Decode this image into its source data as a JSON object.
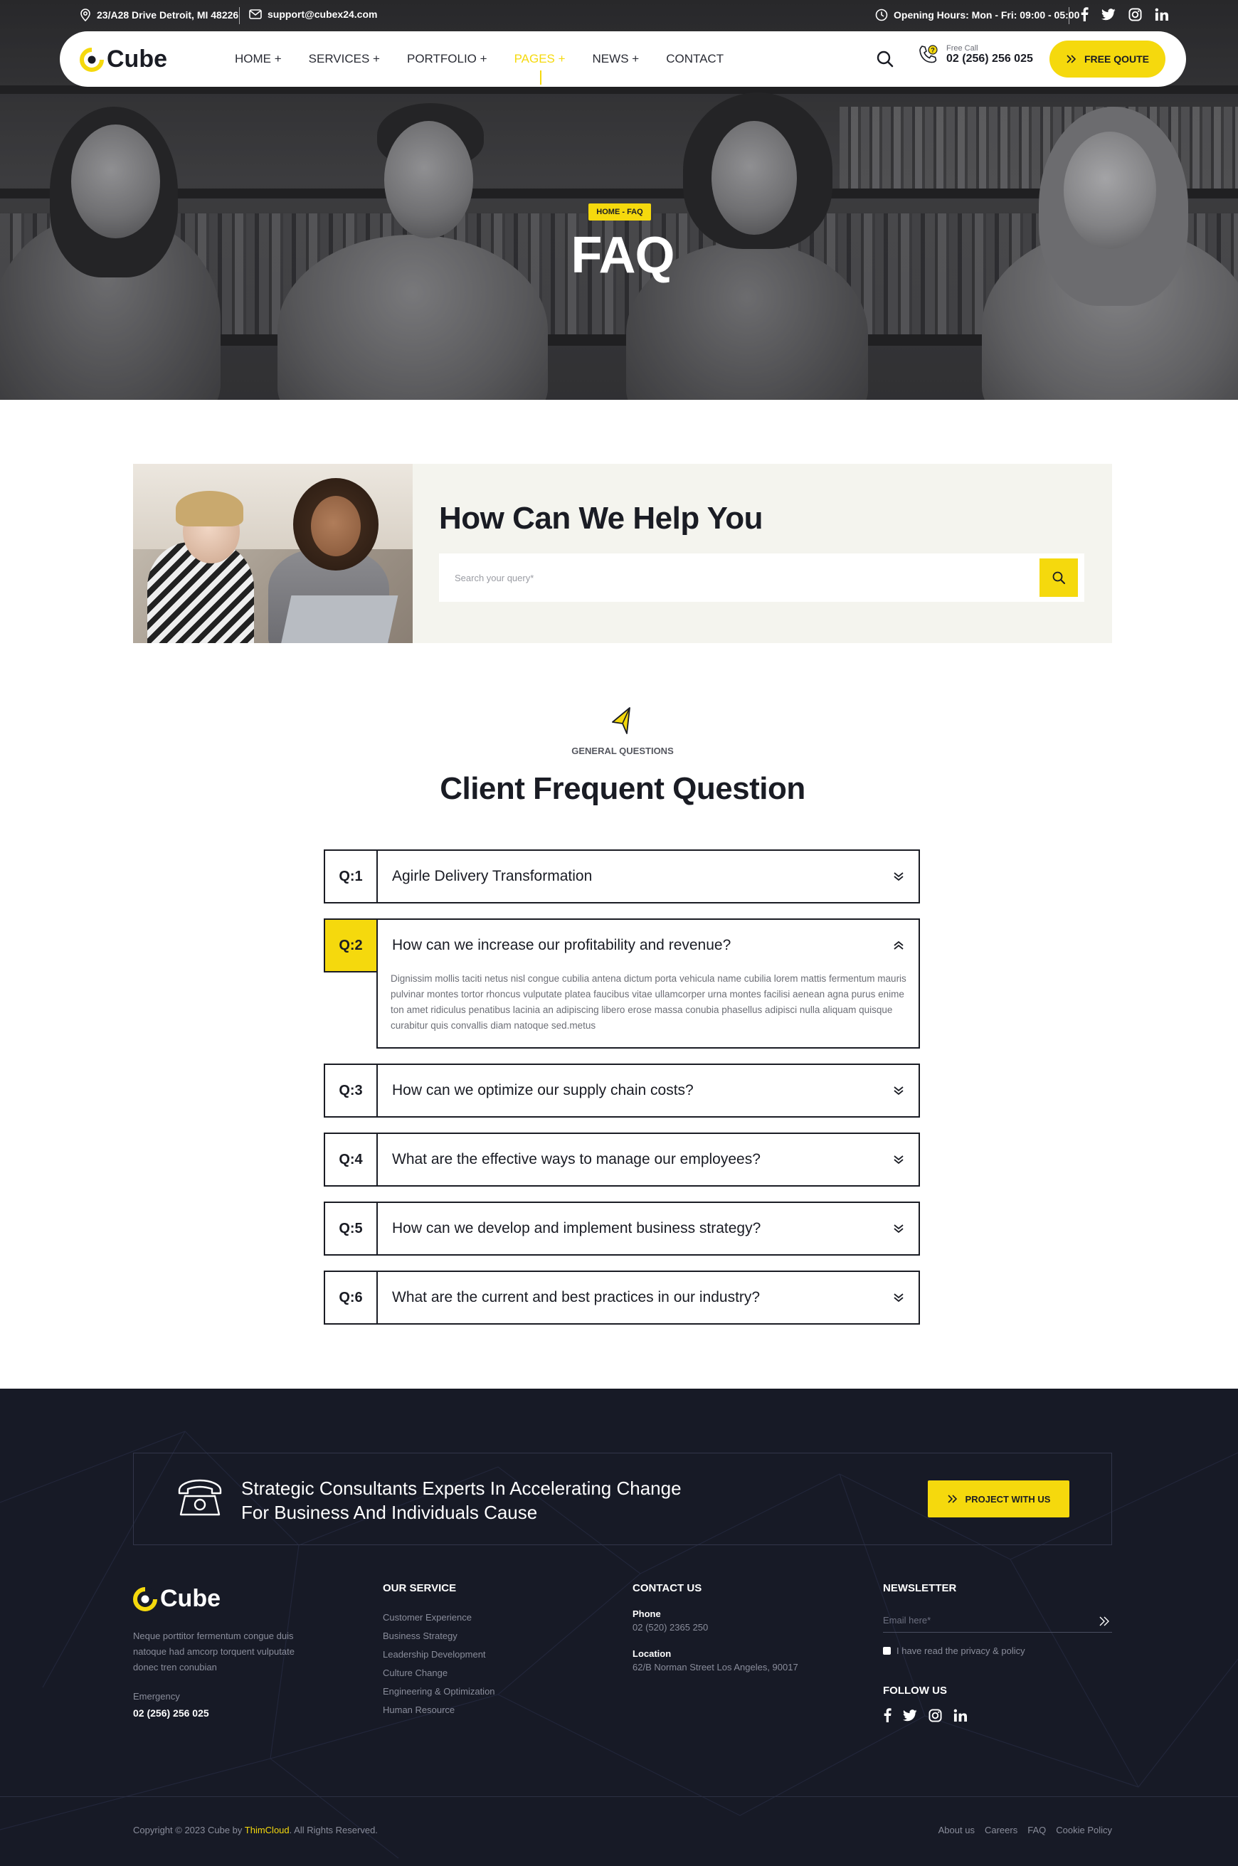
{
  "topbar": {
    "address": "23/A28 Drive Detroit, MI 48226",
    "email": "support@cubex24.com",
    "hours": "Opening Hours: Mon - Fri: 09:00 - 05:00"
  },
  "brand": {
    "name": "Cube",
    "accent": "#f5d90d",
    "dark": "#1a1c24",
    "footer_bg": "#171a26"
  },
  "nav": {
    "items": [
      {
        "label": "HOME +"
      },
      {
        "label": "SERVICES +"
      },
      {
        "label": "PORTFOLIO +"
      },
      {
        "label": "PAGES +",
        "active": true
      },
      {
        "label": "NEWS +"
      },
      {
        "label": "CONTACT"
      }
    ],
    "call_label": "Free Call",
    "call_number": "02 (256) 256 025",
    "quote_label": "FREE QOUTE"
  },
  "hero": {
    "breadcrumb": "HOME - FAQ",
    "title": "FAQ"
  },
  "help": {
    "title": "How Can We Help You",
    "search_placeholder": "Search your query*"
  },
  "faq": {
    "eyebrow": "GENERAL QUESTIONS",
    "heading": "Client Frequent Question",
    "items": [
      {
        "num": "Q:1",
        "question": "Agirle Delivery Transformation",
        "open": false
      },
      {
        "num": "Q:2",
        "question": "How can we increase our profitability and revenue?",
        "open": true,
        "answer": "Dignissim mollis taciti netus nisl congue cubilia antena dictum porta vehicula name cubilia lorem mattis fermentum mauris pulvinar montes tortor rhoncus vulputate platea faucibus vitae ullamcorper urna montes facilisi aenean agna purus enime ton amet ridiculus penatibus lacinia an adipiscing libero erose massa conubia phasellus adipisci nulla aliquam quisque curabitur quis convallis diam natoque sed.metus"
      },
      {
        "num": "Q:3",
        "question": "How can we optimize our supply chain costs?",
        "open": false
      },
      {
        "num": "Q:4",
        "question": "What are the effective ways to manage our employees?",
        "open": false
      },
      {
        "num": "Q:5",
        "question": "How can we develop and implement business strategy?",
        "open": false
      },
      {
        "num": "Q:6",
        "question": "What are the current and best practices in our industry?",
        "open": false
      }
    ]
  },
  "cta": {
    "line1": "Strategic Consultants Experts In Accelerating Change",
    "line2": "For Business And Individuals Cause",
    "button": "PROJECT WITH US"
  },
  "footer": {
    "about": {
      "description": "Neque porttitor fermentum congue duis natoque had amcorp torquent vulputate donec tren conubian",
      "emergency_label": "Emergency",
      "emergency_number": "02 (256) 256 025"
    },
    "services": {
      "title": "OUR SERVICE",
      "links": [
        "Customer Experience",
        "Business Strategy",
        "Leadership Development",
        "Culture Change",
        "Engineering & Optimization",
        "Human Resource"
      ]
    },
    "contact": {
      "title": "CONTACT US",
      "phone_label": "Phone",
      "phone": "02 (520) 2365 250",
      "location_label": "Location",
      "location": "62/B Norman Street Los Angeles, 90017"
    },
    "newsletter": {
      "title": "NEWSLETTER",
      "placeholder": "Email here*",
      "consent": "I have read the privacy & policy",
      "follow_title": "FOLLOW US"
    },
    "copyright_prefix": "Copyright © 2023 Cube by ",
    "copyright_brand": "ThimCloud",
    "copyright_suffix": ". All Rights Reserved.",
    "bottom_links": [
      "About us",
      "Careers",
      "FAQ",
      "Cookie Policy"
    ]
  }
}
